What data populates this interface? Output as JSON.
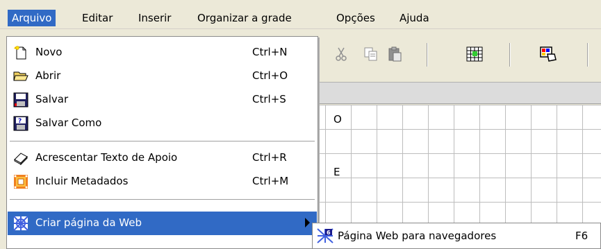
{
  "menubar": {
    "items": [
      "Arquivo",
      "Editar",
      "Inserir",
      "Organizar a grade",
      "Opções",
      "Ajuda"
    ],
    "active_color": "#316ac5"
  },
  "file_menu": {
    "items": [
      {
        "label": "Novo",
        "shortcut": "Ctrl+N",
        "icon": "new-document-icon"
      },
      {
        "label": "Abrir",
        "shortcut": "Ctrl+O",
        "icon": "open-folder-icon"
      },
      {
        "label": "Salvar",
        "shortcut": "Ctrl+S",
        "icon": "save-icon"
      },
      {
        "label": "Salvar Como",
        "shortcut": "",
        "icon": "save-as-icon"
      },
      {
        "label": "Acrescentar Texto de Apoio",
        "shortcut": "Ctrl+R",
        "icon": "eraser-icon"
      },
      {
        "label": "Incluir Metadados",
        "shortcut": "Ctrl+M",
        "icon": "metadata-icon"
      },
      {
        "label": "Criar página da Web",
        "shortcut": "",
        "icon": "web-page-icon"
      }
    ]
  },
  "submenu": {
    "label": "Página Web para navegadores",
    "shortcut": "F6",
    "icon": "web-browser-page-icon"
  },
  "toolbar": {
    "icons": [
      "cut-icon",
      "copy-icon",
      "paste-icon",
      "grid-icon",
      "color-palette-icon"
    ]
  },
  "grid": {
    "letters": [
      "O",
      "E"
    ]
  }
}
